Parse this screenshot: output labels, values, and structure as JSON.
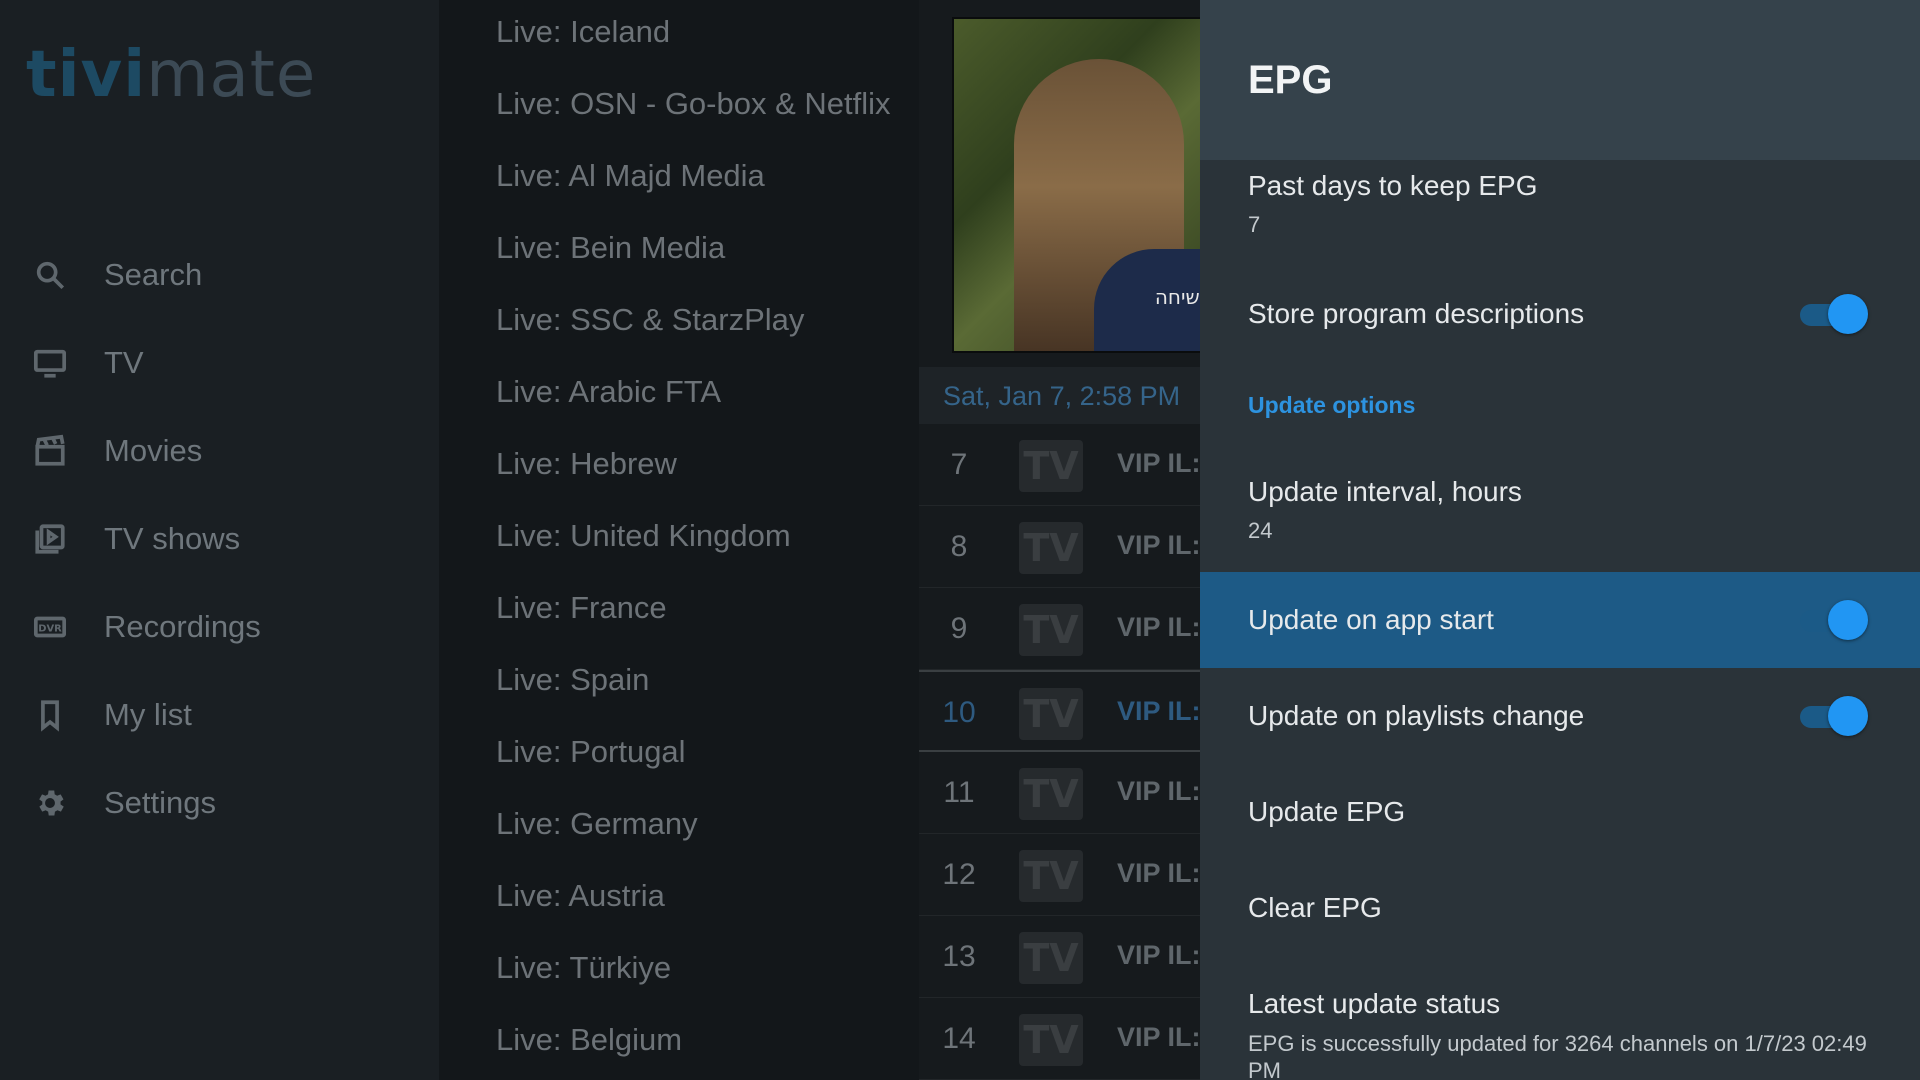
{
  "nav": {
    "logo_part1": "tivi",
    "logo_part2": "mate",
    "items": [
      {
        "label": "Search",
        "icon": "search-icon"
      },
      {
        "label": "TV",
        "icon": "tv-icon"
      },
      {
        "label": "Movies",
        "icon": "clapperboard-icon"
      },
      {
        "label": "TV shows",
        "icon": "tv-shows-icon"
      },
      {
        "label": "Recordings",
        "icon": "dvr-icon"
      },
      {
        "label": "My list",
        "icon": "bookmark-icon"
      },
      {
        "label": "Settings",
        "icon": "gear-icon"
      }
    ]
  },
  "categories": [
    "Live: Iceland",
    "Live: OSN - Go-box & Netflix",
    "Live: Al Majd Media",
    "Live: Bein Media",
    "Live: SSC & StarzPlay",
    "Live: Arabic FTA",
    "Live: Hebrew",
    "Live: United Kingdom",
    "Live: France",
    "Live: Spain",
    "Live: Portugal",
    "Live: Germany",
    "Live: Austria",
    "Live: Türkiye",
    "Live: Belgium"
  ],
  "preview": {
    "caption": "שיחה."
  },
  "guide": {
    "datetime": "Sat, Jan 7, 2:58 PM",
    "logo_text": "TV",
    "channels": [
      {
        "number": "7",
        "name": "VIP IL:"
      },
      {
        "number": "8",
        "name": "VIP IL:"
      },
      {
        "number": "9",
        "name": "VIP IL:"
      },
      {
        "number": "10",
        "name": "VIP IL:",
        "selected": true
      },
      {
        "number": "11",
        "name": "VIP IL:"
      },
      {
        "number": "12",
        "name": "VIP IL:"
      },
      {
        "number": "13",
        "name": "VIP IL:"
      },
      {
        "number": "14",
        "name": "VIP IL:"
      }
    ]
  },
  "panel": {
    "title": "EPG",
    "past_days": {
      "label": "Past days to keep EPG",
      "value": "7"
    },
    "store_descriptions": {
      "label": "Store program descriptions",
      "on": true
    },
    "section_label": "Update options",
    "update_interval": {
      "label": "Update interval, hours",
      "value": "24"
    },
    "update_on_start": {
      "label": "Update on app start",
      "on": true
    },
    "update_on_playlists": {
      "label": "Update on playlists change",
      "on": true
    },
    "update_epg": {
      "label": "Update EPG"
    },
    "clear_epg": {
      "label": "Clear EPG"
    },
    "status": {
      "label": "Latest update status",
      "text": "EPG is successfully updated for 3264 channels on 1/7/23 02:49 PM"
    }
  },
  "colors": {
    "accent": "#2196f3",
    "highlight_row": "#1d5a86",
    "section_label": "#2d93e0"
  }
}
